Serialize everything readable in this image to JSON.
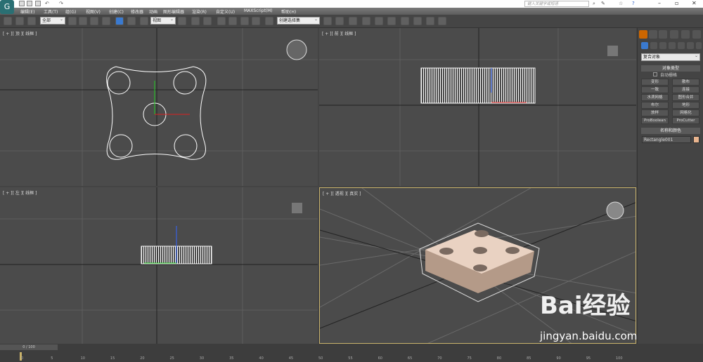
{
  "titlebar": {
    "search_placeholder": "键入关键字或短语"
  },
  "menus": [
    "编辑(E)",
    "工具(T)",
    "组(G)",
    "视图(V)",
    "创建(C)",
    "修改器",
    "动画",
    "图形编辑器",
    "渲染(R)",
    "自定义(U)",
    "MAXScript(M)",
    "帮助(H)"
  ],
  "toolbar": {
    "selection_filter": "全部",
    "reference_coord": "视图",
    "named_selection": "创建选择集"
  },
  "viewports": [
    {
      "label": "[ + ][ 顶 ][ 线框 ]"
    },
    {
      "label": "[ + ][ 前 ][ 线框 ]"
    },
    {
      "label": "[ + ][ 左 ][ 线框 ]"
    },
    {
      "label": "[ + ][ 透视 ][ 真实 ]"
    }
  ],
  "command_panel": {
    "category": "复合对象",
    "object_type_header": "对象类型",
    "autogrid": "自动栅格",
    "buttons": [
      "变形",
      "散布",
      "一致",
      "连接",
      "水滴网格",
      "图形合并",
      "布尔",
      "地形",
      "放样",
      "网格化",
      "ProBoolean",
      "ProCutter"
    ],
    "name_color_header": "名称和颜色",
    "object_name": "Rectangle001",
    "object_color": "#e8b48e"
  },
  "timeline": {
    "frame_display": "0 / 100",
    "ticks": [
      "0",
      "5",
      "10",
      "15",
      "20",
      "25",
      "30",
      "35",
      "40",
      "45",
      "50",
      "55",
      "60",
      "65",
      "70",
      "75",
      "80",
      "85",
      "90",
      "95",
      "100"
    ]
  },
  "watermark": {
    "brand": "Bai经验",
    "url": "jingyan.baidu.com"
  }
}
